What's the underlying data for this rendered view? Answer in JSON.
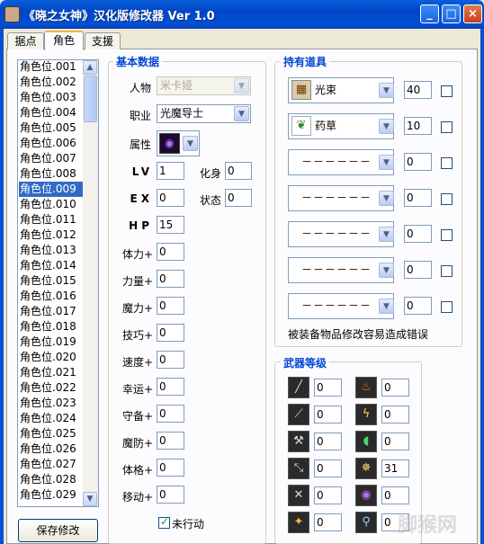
{
  "window": {
    "title": "《晓之女神》汉化版修改器 Ver 1.0",
    "minimize": "_",
    "maximize": "□",
    "close": "×"
  },
  "tabs": [
    {
      "label": "据点"
    },
    {
      "label": "角色"
    },
    {
      "label": "支援"
    }
  ],
  "char_list": [
    "角色位.001",
    "角色位.002",
    "角色位.003",
    "角色位.004",
    "角色位.005",
    "角色位.006",
    "角色位.007",
    "角色位.008",
    "角色位.009",
    "角色位.010",
    "角色位.011",
    "角色位.012",
    "角色位.013",
    "角色位.014",
    "角色位.015",
    "角色位.016",
    "角色位.017",
    "角色位.018",
    "角色位.019",
    "角色位.020",
    "角色位.021",
    "角色位.022",
    "角色位.023",
    "角色位.024",
    "角色位.025",
    "角色位.026",
    "角色位.027",
    "角色位.028",
    "角色位.029"
  ],
  "selected_index": 8,
  "save_button": "保存修改",
  "basic": {
    "title": "基本数据",
    "person_label": "人物",
    "person_value": "米卡娅",
    "class_label": "职业",
    "class_value": "光魔导士",
    "attr_label": "属性",
    "lv_label": "LV",
    "lv": "1",
    "transform_label": "化身",
    "transform": "0",
    "ex_label": "EX",
    "ex": "0",
    "state_label": "状态",
    "state": "0",
    "hp_label": "HP",
    "hp": "15",
    "stats": [
      {
        "label": "体力+",
        "value": "0"
      },
      {
        "label": "力量+",
        "value": "0"
      },
      {
        "label": "魔力+",
        "value": "0"
      },
      {
        "label": "技巧+",
        "value": "0"
      },
      {
        "label": "速度+",
        "value": "0"
      },
      {
        "label": "幸运+",
        "value": "0"
      },
      {
        "label": "守备+",
        "value": "0"
      },
      {
        "label": "魔防+",
        "value": "0"
      },
      {
        "label": "体格+",
        "value": "0"
      },
      {
        "label": "移动+",
        "value": "0"
      }
    ],
    "not_acted_label": "未行动"
  },
  "items": {
    "title": "持有道具",
    "rows": [
      {
        "name": "光束",
        "icon": "book-icon",
        "count": "40"
      },
      {
        "name": "药草",
        "icon": "leaf-icon",
        "count": "10"
      },
      {
        "name": "－－－－－－",
        "icon": "",
        "count": "0"
      },
      {
        "name": "－－－－－－",
        "icon": "",
        "count": "0"
      },
      {
        "name": "－－－－－－",
        "icon": "",
        "count": "0"
      },
      {
        "name": "－－－－－－",
        "icon": "",
        "count": "0"
      },
      {
        "name": "－－－－－－",
        "icon": "",
        "count": "0"
      }
    ],
    "warning": "被装备物品修改容易造成错误"
  },
  "weapons": {
    "title": "武器等级",
    "left": [
      {
        "icon": "sword-icon",
        "value": "0"
      },
      {
        "icon": "lance-icon",
        "value": "0"
      },
      {
        "icon": "axe-icon",
        "value": "0"
      },
      {
        "icon": "bow-icon",
        "value": "0"
      },
      {
        "icon": "knife-icon",
        "value": "0"
      },
      {
        "icon": "strike-icon",
        "value": "0"
      }
    ],
    "right": [
      {
        "icon": "fire-icon",
        "value": "0"
      },
      {
        "icon": "thunder-icon",
        "value": "0"
      },
      {
        "icon": "wind-icon",
        "value": "0"
      },
      {
        "icon": "light-icon",
        "value": "31"
      },
      {
        "icon": "dark-icon",
        "value": "0"
      },
      {
        "icon": "staff-icon",
        "value": "0"
      }
    ]
  },
  "watermark": "脚猴网"
}
